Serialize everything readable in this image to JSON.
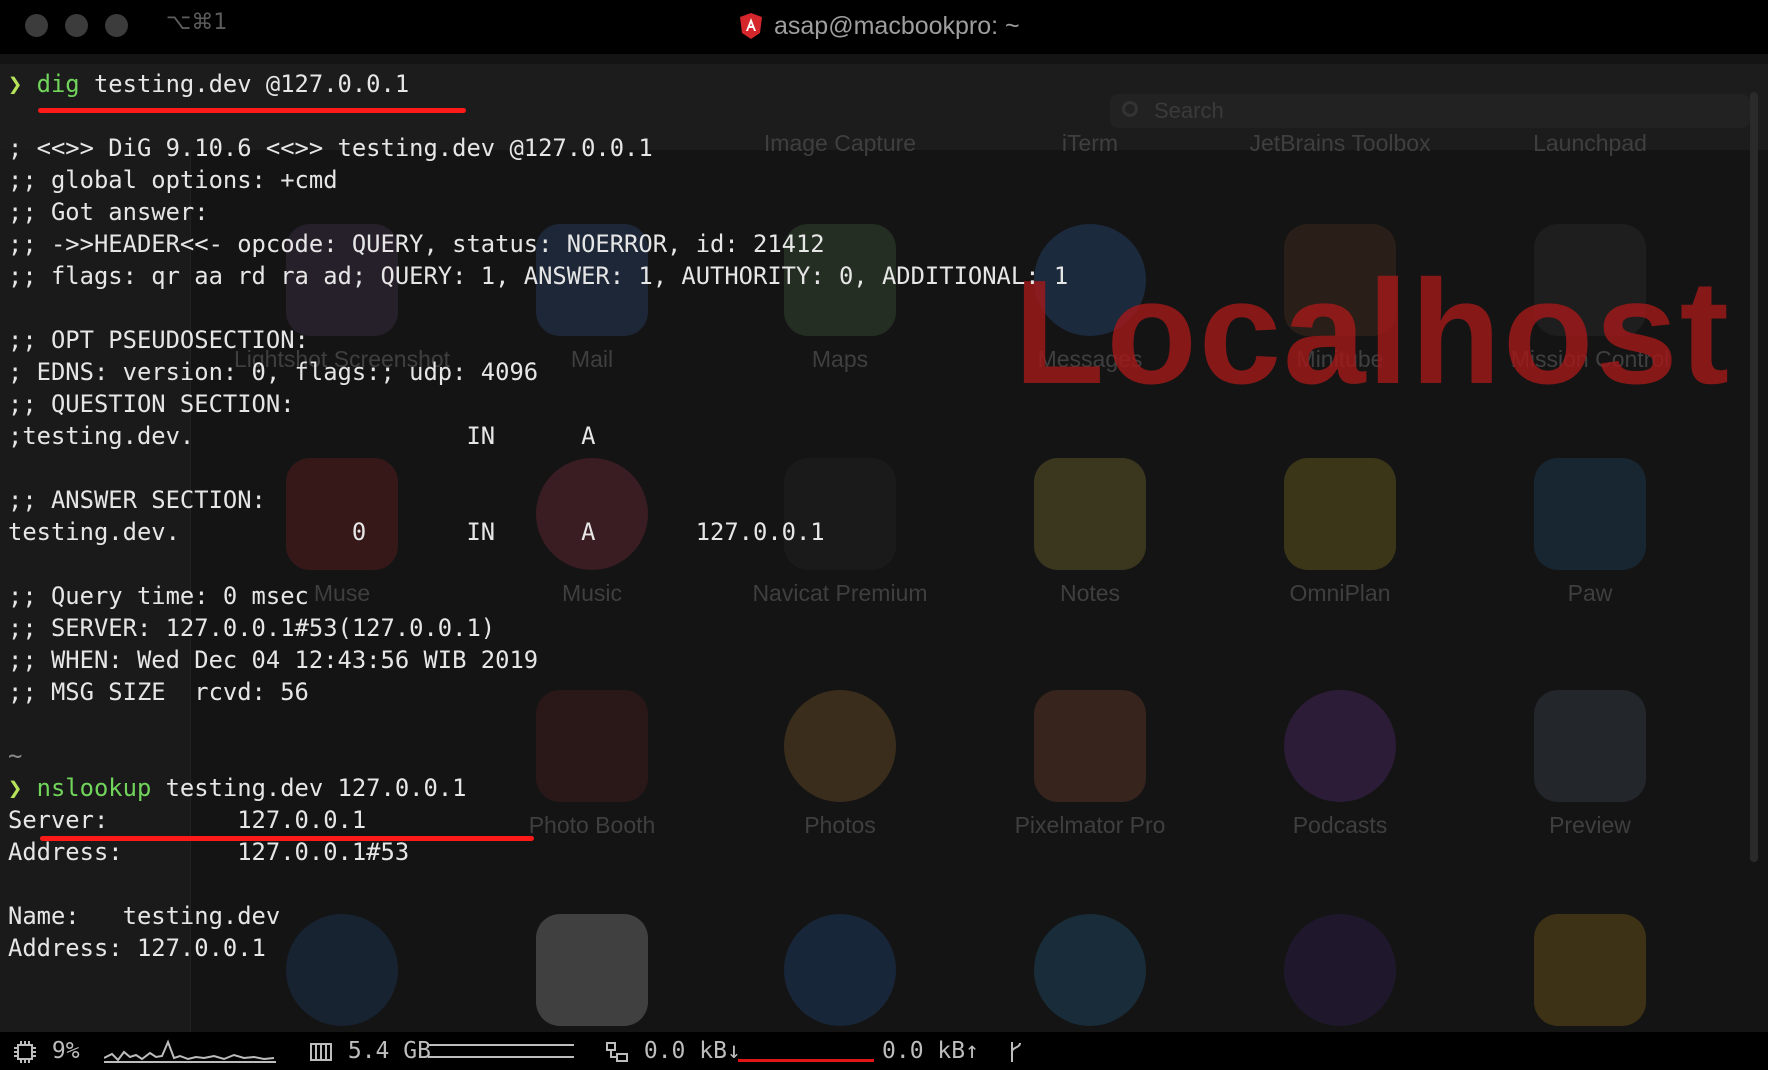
{
  "window": {
    "title": "asap@macbookpro: ~",
    "tab_shortcut": "⌥⌘1"
  },
  "background": {
    "search_placeholder": "Search",
    "apps": [
      "Image Capture",
      "iTerm",
      "JetBrains Toolbox",
      "Launchpad",
      "Lightshot Screenshot",
      "Mail",
      "Maps",
      "Messages",
      "Minitube",
      "Mission Control",
      "Muse",
      "Music",
      "Navicat Premium",
      "Notes",
      "OmniPlan",
      "Paw",
      "Photo Booth",
      "Photos",
      "Pixelmator Pro",
      "Podcasts",
      "Preview"
    ]
  },
  "terminal": {
    "prompt": "❯",
    "cmd1": {
      "command": "dig",
      "args": " testing.dev @127.0.0.1"
    },
    "dig_output": [
      "; <<>> DiG 9.10.6 <<>> testing.dev @127.0.0.1",
      ";; global options: +cmd",
      ";; Got answer:",
      ";; ->>HEADER<<- opcode: QUERY, status: NOERROR, id: 21412",
      ";; flags: qr aa rd ra ad; QUERY: 1, ANSWER: 1, AUTHORITY: 0, ADDITIONAL: 1",
      "",
      ";; OPT PSEUDOSECTION:",
      "; EDNS: version: 0, flags:; udp: 4096",
      ";; QUESTION SECTION:",
      ";testing.dev.                   IN      A",
      "",
      ";; ANSWER SECTION:",
      "testing.dev.            0       IN      A       127.0.0.1",
      "",
      ";; Query time: 0 msec",
      ";; SERVER: 127.0.0.1#53(127.0.0.1)",
      ";; WHEN: Wed Dec 04 12:43:56 WIB 2019",
      ";; MSG SIZE  rcvd: 56",
      ""
    ],
    "tilde": "~",
    "cmd2": {
      "command": "nslookup",
      "args": " testing.dev 127.0.0.1"
    },
    "nslookup_output": [
      "Server:         127.0.0.1",
      "Address:        127.0.0.1#53",
      "",
      "Name:   testing.dev",
      "Address: 127.0.0.1"
    ]
  },
  "watermark": "Localhost",
  "status_bar": {
    "cpu": "9%",
    "memory": "5.4 GB",
    "net_down": "0.0 kB↓",
    "net_up": "0.0 kB↑"
  },
  "colors": {
    "underline": "#ff1a1a",
    "command": "#71d45b",
    "watermark": "#a1191a"
  }
}
